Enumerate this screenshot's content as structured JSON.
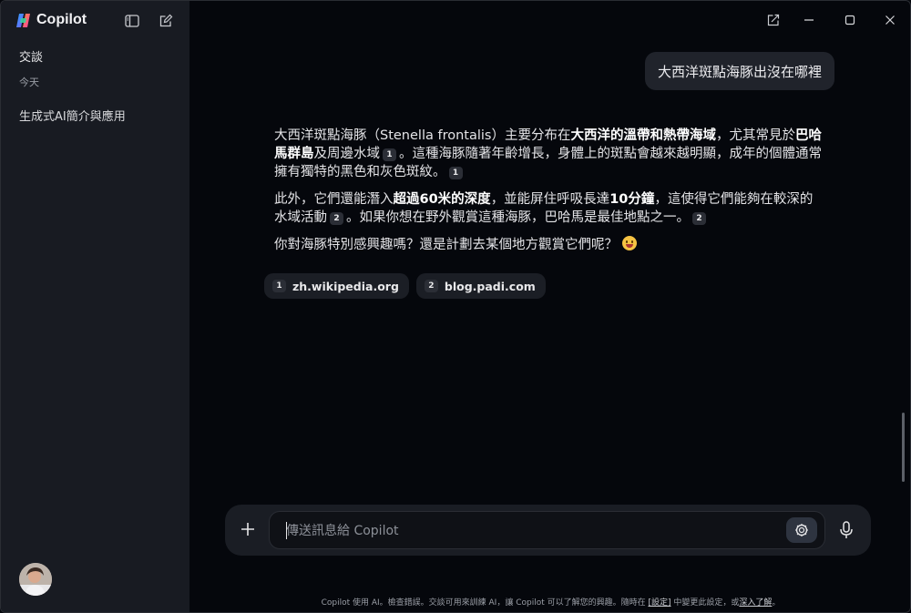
{
  "app": {
    "name": "Copilot"
  },
  "sidebar": {
    "section_title": "交談",
    "date_group": "今天",
    "conversations": [
      "生成式AI簡介與應用"
    ]
  },
  "conversation": {
    "user_message": "大西洋斑點海豚出沒在哪裡",
    "answer": {
      "p1": {
        "t1": "大西洋斑點海豚（",
        "latin": "Stenella frontalis",
        "t2": "）主要分布在",
        "b1": "大西洋的溫帶和熱帶海域",
        "t3": "，尤其常見於",
        "b2": "巴哈馬群島",
        "t4": "及周邊水域",
        "c1": "1",
        "t5": "。這種海豚隨著年齡增長，身體上的斑點會越來越明顯，成年的個體通常擁有獨特的黑色和灰色斑紋。",
        "c2": "1"
      },
      "p2": {
        "t1": "此外，它們還能潛入",
        "b1": "超過60米的深度",
        "t2": "，並能屏住呼吸長達",
        "b2": "10分鐘",
        "t3": "，這使得它們能夠在較深的水域活動",
        "c1": "2",
        "t4": "。如果你想在野外觀賞這種海豚，巴哈馬是最佳地點之一。",
        "c2": "2"
      },
      "p3": {
        "t1": "你對海豚特別感興趣嗎？還是計劃去某個地方觀賞它們呢？"
      }
    },
    "sources": [
      {
        "index": "1",
        "domain": "zh.wikipedia.org"
      },
      {
        "index": "2",
        "domain": "blog.padi.com"
      }
    ]
  },
  "composer": {
    "placeholder": "傳送訊息給 Copilot"
  },
  "footer": {
    "t1": "Copilot 使用 AI。檢查錯誤。交談可用來訓練 AI，讓 Copilot 可以了解您的興趣。隨時在 ",
    "settings": "[設定]",
    "t2": " 中變更此設定，或",
    "learn_more": "深入了解",
    "t3": "。"
  },
  "colors": {
    "background": "#05070c",
    "sidebar": "#181b22",
    "bubble": "#20232b",
    "composer": "#1a1d24"
  },
  "icons": [
    "copilot-logo-icon",
    "sidebar-toggle-icon",
    "new-chat-icon",
    "pop-out-icon",
    "minimize-icon",
    "maximize-icon",
    "close-icon",
    "plus-icon",
    "think-deeper-icon",
    "microphone-icon"
  ]
}
